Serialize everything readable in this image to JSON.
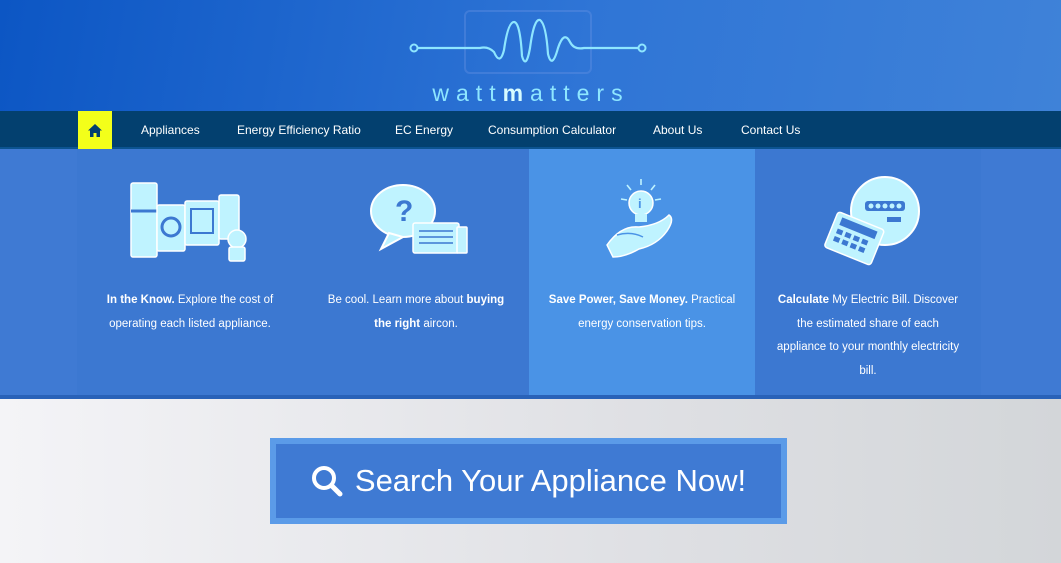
{
  "brand": {
    "logo_part1": "watt",
    "logo_part2": "m",
    "logo_part3": "atters"
  },
  "nav": {
    "home_icon": "home-icon",
    "items": [
      {
        "label": "Appliances"
      },
      {
        "label": "Energy Efficiency Ratio"
      },
      {
        "label": "EC Energy"
      },
      {
        "label": "Consumption Calculator"
      },
      {
        "label": "About Us"
      },
      {
        "label": "Contact Us"
      }
    ]
  },
  "features": [
    {
      "icon": "appliances-icon",
      "bold1": "In the Know.",
      "text1": " Explore the cost of operating each listed appliance."
    },
    {
      "icon": "aircon-question-icon",
      "text1": "Be cool. Learn more about ",
      "bold1": "buying the right",
      "text2": " aircon."
    },
    {
      "icon": "lightbulb-hand-icon",
      "bold1": "Save Power, Save Money.",
      "text1": " Practical energy conservation tips."
    },
    {
      "icon": "calculator-meter-icon",
      "bold1": "Calculate",
      "text1": " My Electric Bill. Discover the estimated share of each appliance to your monthly electricity bill."
    }
  ],
  "search": {
    "label": "Search Your Appliance Now!",
    "icon": "search-icon"
  },
  "colors": {
    "header_blue": "#1a63cc",
    "nav_bg": "#03406f",
    "home_highlight": "#f3ff1a",
    "band_bg": "#3f7ad3",
    "active_panel": "#4a93e6",
    "logo_cyan": "#8ee6ff"
  }
}
